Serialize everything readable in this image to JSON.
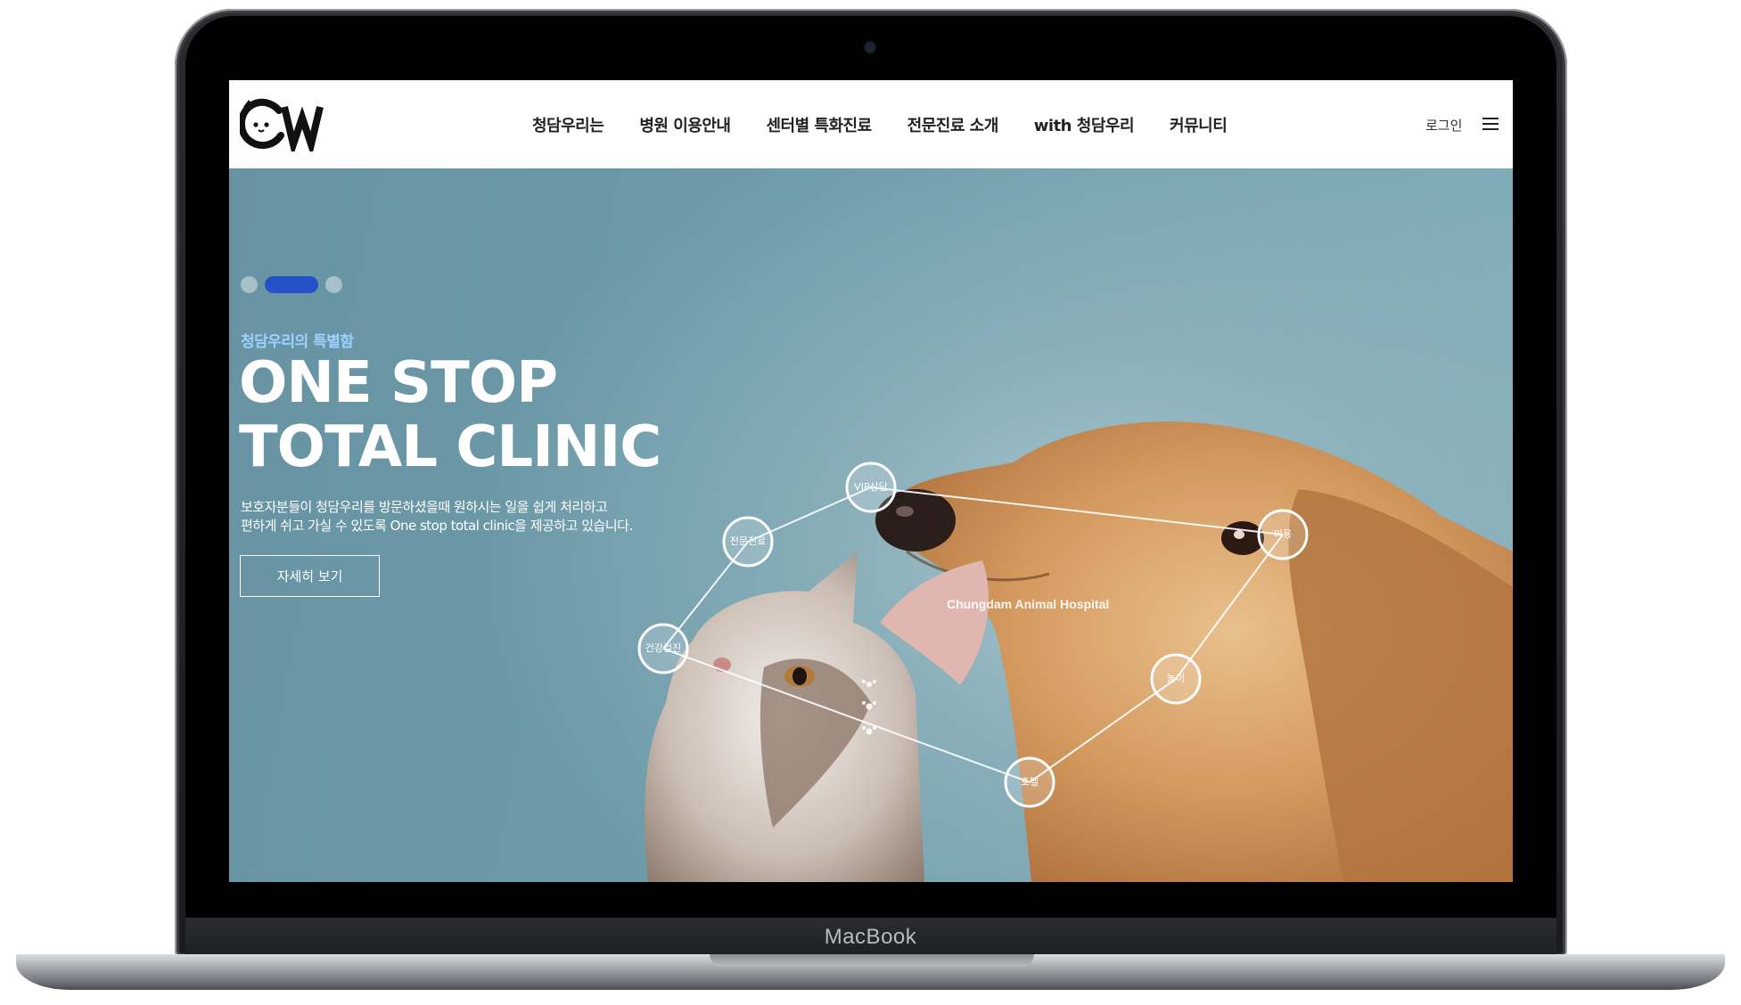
{
  "device": {
    "label": "MacBook"
  },
  "header": {
    "logo_text": "CW",
    "nav": [
      {
        "label": "청담우리는"
      },
      {
        "label": "병원 이용안내"
      },
      {
        "label": "센터별 특화진료"
      },
      {
        "label": "전문진료 소개"
      },
      {
        "label": "with 청담우리"
      },
      {
        "label": "커뮤니티"
      }
    ],
    "login_label": "로그인",
    "menu_icon": "hamburger-menu-icon"
  },
  "hero": {
    "slides_count": 3,
    "active_slide": 2,
    "eyebrow": "청담우리의 특별함",
    "headline_line1": "ONE STOP",
    "headline_line2": "TOTAL CLINIC",
    "desc_line1": "보호자분들이 청담우리를 방문하셨을때 원하시는 일을 쉽게 처리하고",
    "desc_line2": "편하게 쉬고 가실 수 있도록 One stop total clinic을 제공하고 있습니다.",
    "button_label": "자세히 보기",
    "diagram": {
      "center_label": "Chungdam Animal Hospital",
      "nodes": [
        "VIP상담",
        "전문진료",
        "미용",
        "건강검진",
        "놀이",
        "호텔"
      ]
    }
  },
  "colors": {
    "accent": "#2452c6",
    "eyebrow": "#9fd1ff",
    "hero_bg": "#6e9aa9"
  }
}
